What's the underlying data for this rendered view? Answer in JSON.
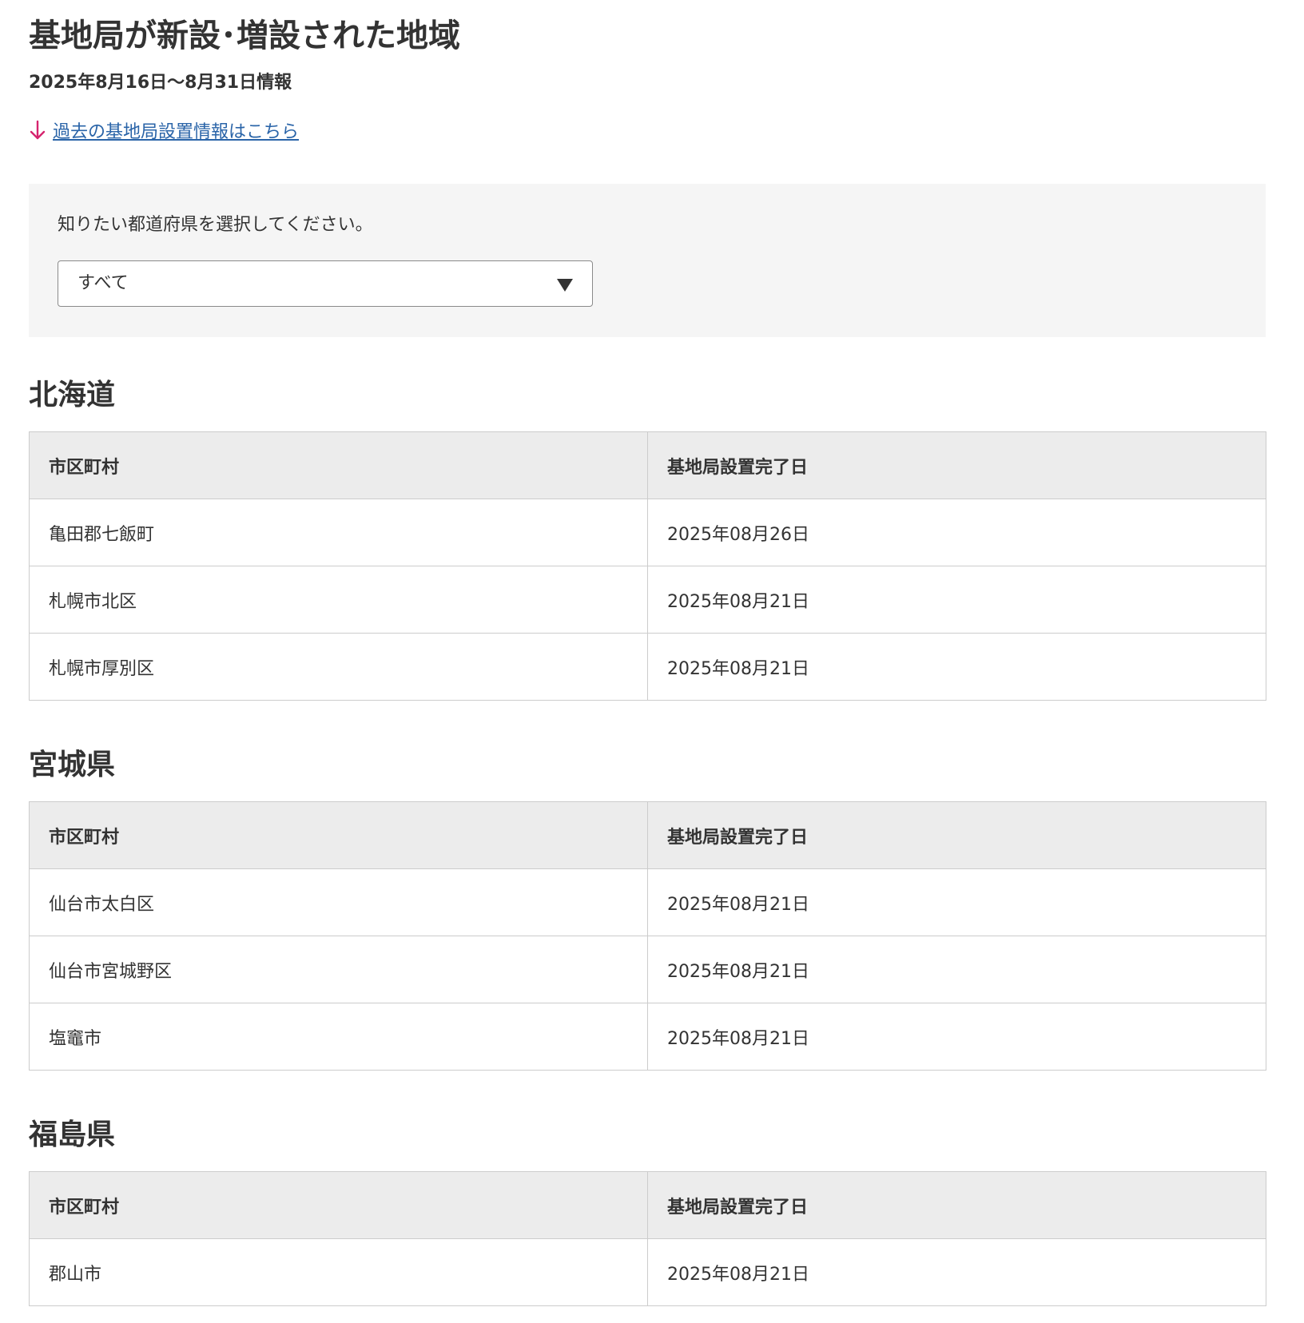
{
  "header": {
    "title": "基地局が新設･増設された地域",
    "subtitle": "2025年8月16日～8月31日情報",
    "past_link": "過去の基地局設置情報はこちら"
  },
  "filter": {
    "label": "知りたい都道府県を選択してください。",
    "selected": "すべて"
  },
  "table_headers": {
    "municipality": "市区町村",
    "completion_date": "基地局設置完了日"
  },
  "sections": [
    {
      "prefecture": "北海道",
      "rows": [
        {
          "municipality": "亀田郡七飯町",
          "date": "2025年08月26日"
        },
        {
          "municipality": "札幌市北区",
          "date": "2025年08月21日"
        },
        {
          "municipality": "札幌市厚別区",
          "date": "2025年08月21日"
        }
      ]
    },
    {
      "prefecture": "宮城県",
      "rows": [
        {
          "municipality": "仙台市太白区",
          "date": "2025年08月21日"
        },
        {
          "municipality": "仙台市宮城野区",
          "date": "2025年08月21日"
        },
        {
          "municipality": "塩竈市",
          "date": "2025年08月21日"
        }
      ]
    },
    {
      "prefecture": "福島県",
      "rows": [
        {
          "municipality": "郡山市",
          "date": "2025年08月21日"
        }
      ]
    }
  ],
  "colors": {
    "link": "#2a64a8",
    "arrow_accent": "#d6246e",
    "panel_bg": "#f5f5f5",
    "table_header_bg": "#ececec",
    "border": "#cccccc",
    "text": "#333333"
  },
  "icons": {
    "link_arrow": "arrow-down-icon",
    "select_arrow": "triangle-down-icon"
  }
}
